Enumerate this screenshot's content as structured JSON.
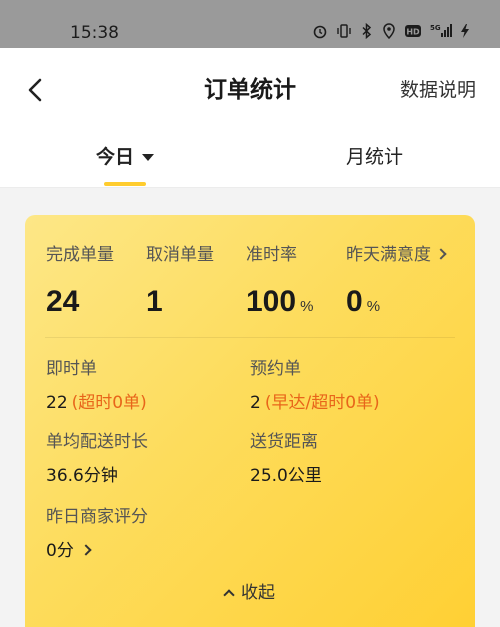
{
  "status_bar": {
    "time": "15:38",
    "icons": [
      "alarm-icon",
      "vibrate-icon",
      "bluetooth-icon",
      "location-icon",
      "hd-icon",
      "5g-signal-icon",
      "battery-charging-icon"
    ]
  },
  "nav": {
    "title": "订单统计",
    "action": "数据说明"
  },
  "tabs": [
    {
      "label": "今日",
      "active": true
    },
    {
      "label": "月统计",
      "active": false
    }
  ],
  "colors": {
    "accent": "#ffcc2e",
    "card_start": "#fde787",
    "card_end": "#ffd034",
    "highlight_text": "#e8651a"
  },
  "metrics": [
    {
      "label": "完成单量",
      "value": "24",
      "unit": ""
    },
    {
      "label": "取消单量",
      "value": "1",
      "unit": ""
    },
    {
      "label": "准时率",
      "value": "100",
      "unit": "%"
    },
    {
      "label": "昨天满意度",
      "value": "0",
      "unit": "%"
    }
  ],
  "details": {
    "instant": {
      "label": "即时单",
      "value": "22",
      "sub": "(超时0单)"
    },
    "reserved": {
      "label": "预约单",
      "value": "2",
      "sub": "(早达/超时0单)"
    },
    "avg_time": {
      "label": "单均配送时长",
      "value": "36.6分钟"
    },
    "distance": {
      "label": "送货距离",
      "value": "25.0公里"
    },
    "merchant_rating": {
      "label": "昨日商家评分",
      "value": "0分"
    }
  },
  "collapse_label": "收起"
}
